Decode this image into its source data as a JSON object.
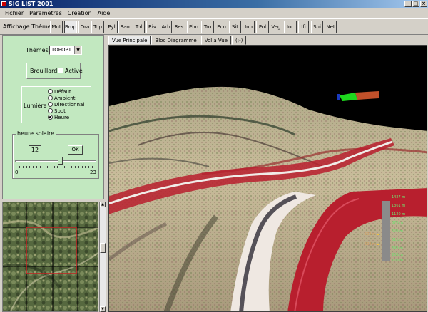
{
  "window": {
    "title": "SIG LIST 2001",
    "minimize": "_",
    "maximize": "□",
    "close": "×"
  },
  "menu": [
    "Fichier",
    "Paramètres",
    "Création",
    "Aide"
  ],
  "toolbar": {
    "label": "Affichage Thèmes :",
    "buttons": [
      "Mnt",
      "Bmp",
      "Ora",
      "Top",
      "Pyl",
      "Bao",
      "Tol",
      "Riv",
      "Arb",
      "Res",
      "Pho",
      "Tro",
      "Eco",
      "Sit",
      "Ino",
      "Pol",
      "Veg",
      "Inc",
      "Ifi",
      "Sui",
      "Net"
    ],
    "active": "Bmp"
  },
  "panel": {
    "themes_label": "Thèmes",
    "themes_value": "TOPOPT",
    "fog_label": "Brouillard",
    "fog_checkbox_label": "Activé",
    "fog_checked": false,
    "light_label": "Lumière",
    "light_options": [
      "Défaut",
      "Ambient",
      "Directionnal",
      "Spot",
      "Heure"
    ],
    "light_selected": "Heure",
    "sun_group_label": "heure solaire",
    "sun_hour": "12",
    "ok_label": "OK",
    "slider_min": "0",
    "slider_max": "23",
    "slider_value": 13,
    "slider_range_max": 23
  },
  "tabs": [
    "Vue Principale",
    "Bloc Diagramme",
    "Vol à Vue",
    "(;-)"
  ],
  "active_tab": "Vue Principale",
  "altitude_legend": {
    "right": [
      "1427 m",
      "1361 m",
      "1120 m",
      "870 m",
      "628 m",
      "511 m",
      "393 m",
      "253 m",
      "170 m"
    ],
    "left": [
      "502 m",
      "628 m"
    ]
  },
  "colors": {
    "panel_bg": "#c2e8c0",
    "sky": "#000000",
    "road_red": "#b81f2e",
    "terrain": "#c8b898",
    "title_blue": "#0a246a",
    "legend_green": "#6fe36f"
  }
}
